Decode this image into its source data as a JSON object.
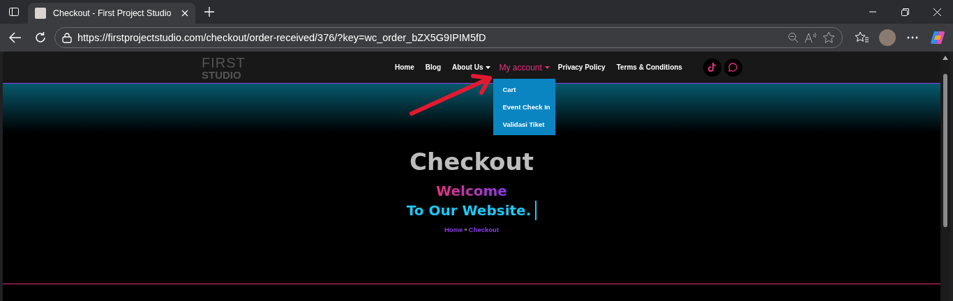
{
  "browser": {
    "tab": {
      "title": "Checkout - First Project Studio",
      "selected": true
    },
    "address": "https://firstprojectstudio.com/checkout/order-received/376/?key=wc_order_bZX5G9IPIM5fD"
  },
  "header": {
    "logo": {
      "line1": "FIRST",
      "line2": "STUDIO"
    },
    "nav": [
      {
        "label": "Home",
        "selected": false,
        "has_submenu": false
      },
      {
        "label": "Blog",
        "selected": false,
        "has_submenu": false
      },
      {
        "label": "About Us",
        "selected": false,
        "has_submenu": true
      },
      {
        "label": "My account",
        "selected": true,
        "has_submenu": true,
        "expanded": true,
        "submenu": [
          "Cart",
          "Event Check In",
          "Validasi Tiket"
        ]
      },
      {
        "label": "Privacy Policy",
        "selected": false,
        "has_submenu": false
      },
      {
        "label": "Terms & Conditions",
        "selected": false,
        "has_submenu": false
      }
    ],
    "social": [
      {
        "kind": "tiktok"
      },
      {
        "kind": "whatsapp"
      }
    ]
  },
  "hero": {
    "title": "Checkout",
    "welcome": "Welcome",
    "tagline": "To Our Website.",
    "breadcrumb": [
      "Home",
      "»",
      "Checkout"
    ]
  }
}
